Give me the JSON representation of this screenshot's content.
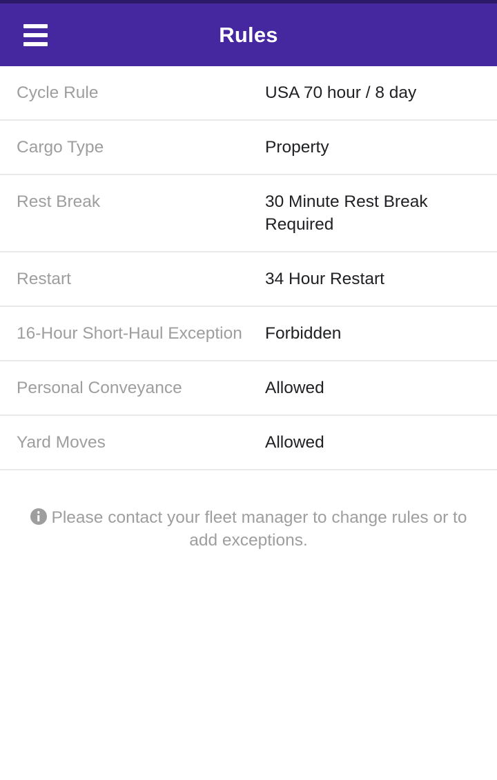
{
  "appbar": {
    "title": "Rules",
    "menu_icon": "hamburger-menu-icon",
    "background_color": "#4527a0",
    "title_color": "#ffffff"
  },
  "colors": {
    "accent": "#4527a0",
    "status_bar": "#2b1a66",
    "label": "#9e9e9e",
    "value": "#202124",
    "divider": "#e9e9e9",
    "page_background": "#ffffff"
  },
  "rules": [
    {
      "label": "Cycle Rule",
      "value": "USA 70 hour / 8 day"
    },
    {
      "label": "Cargo Type",
      "value": "Property"
    },
    {
      "label": "Rest Break",
      "value": "30 Minute Rest Break Required"
    },
    {
      "label": "Restart",
      "value": "34 Hour Restart"
    },
    {
      "label": "16-Hour Short-Haul Exception",
      "value": "Forbidden"
    },
    {
      "label": "Personal Conveyance",
      "value": "Allowed"
    },
    {
      "label": "Yard Moves",
      "value": "Allowed"
    }
  ],
  "footer": {
    "icon": "info-circle-icon",
    "text": "Please contact your fleet manager to change rules or to add exceptions."
  }
}
